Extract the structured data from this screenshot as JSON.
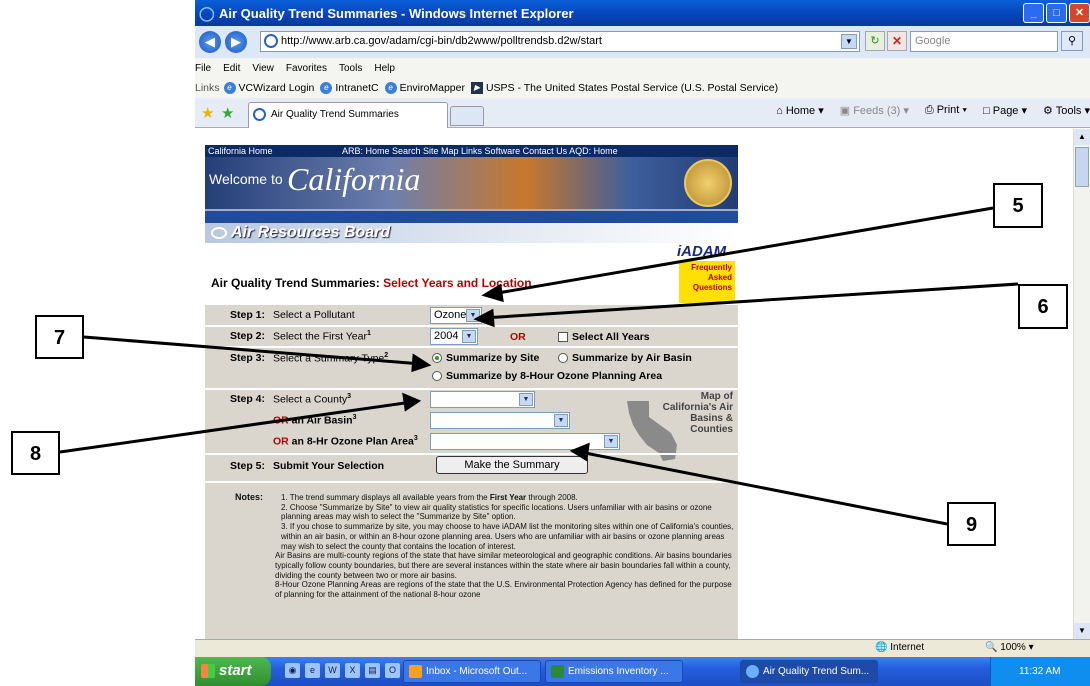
{
  "browser": {
    "title": "Air Quality Trend Summaries - Windows Internet Explorer",
    "url": "http://www.arb.ca.gov/adam/cgi-bin/db2www/polltrendsb.d2w/start",
    "search_placeholder": "Google",
    "menu": [
      "File",
      "Edit",
      "View",
      "Favorites",
      "Tools",
      "Help"
    ],
    "links_label": "Links",
    "links": [
      "VCWizard Login",
      "IntranetC",
      "EnviroMapper",
      "USPS - The United States Postal Service (U.S. Postal Service)"
    ],
    "tab_label": "Air Quality Trend Summaries",
    "commands": {
      "home": "Home",
      "feeds": "Feeds (3)",
      "print": "Print",
      "page": "Page",
      "tools": "Tools"
    },
    "status_zone": "Internet",
    "zoom": "100%"
  },
  "site": {
    "top_left": "California Home",
    "top_links": "ARB: Home  Search  Site Map  Links  Software  Contact Us  AQD: Home",
    "welcome": "Welcome to",
    "california": "California",
    "board": "Air Resources Board",
    "iadam_logo": "iADAM",
    "faq": "Frequently Asked Questions",
    "title_main": "Air Quality Trend Summaries:",
    "title_sub": "Select Years and Location"
  },
  "form": {
    "step1": {
      "label": "Step 1:",
      "text": "Select a Pollutant",
      "value": "Ozone"
    },
    "step2": {
      "label": "Step 2:",
      "text": "Select the First Year",
      "sup": "1",
      "value": "2004",
      "or": "OR",
      "all_years": "Select All Years"
    },
    "step3": {
      "label": "Step 3:",
      "text": "Select a Summary Type",
      "sup": "2",
      "opt_site": "Summarize by Site",
      "opt_basin": "Summarize by Air Basin",
      "opt_ozone": "Summarize by 8-Hour Ozone Planning Area"
    },
    "step4": {
      "label": "Step 4:",
      "text": "Select a County",
      "sup": "3",
      "or": "OR",
      "basin_text": "an Air Basin",
      "plan_text": "an 8-Hr Ozone Plan Area"
    },
    "step5": {
      "label": "Step 5:",
      "text": "Submit Your Selection",
      "button": "Make the Summary"
    },
    "map_text": "Map of California's Air Basins & Counties"
  },
  "notes": {
    "heading": "Notes:",
    "n1_pre": "1. The trend summary displays all available years from the ",
    "n1_bold": "First Year",
    "n1_post": " through 2008.",
    "n2": "2. Choose \"Summarize by Site\" to view air quality statistics for specific locations. Users unfamiliar with air basins or ozone planning areas may wish to select the \"Summarize by Site\" option.",
    "n3": "3. If you chose to summarize by site, you may choose to have iADAM list the monitoring sites within one of California's counties, within an air basin, or within an 8-hour ozone planning area. Users who are unfamiliar with air basins or ozone planning areas may wish to select the county that contains the location of interest.",
    "n4": "Air Basins are multi-county regions of the state that have similar meteorological and geographic conditions. Air basins boundaries typically follow county boundaries, but there are several instances within the state where air basin boundaries fall within a county, dividing the county between two or more air basins.",
    "n5": "8-Hour Ozone Planning Areas are regions of the state that the U.S. Environmental Protection Agency has defined for the purpose of planning for the attainment of the national 8-hour ozone"
  },
  "taskbar": {
    "start": "start",
    "tasks": [
      "Inbox - Microsoft Out...",
      "Emissions Inventory ...",
      "Air Quality Trend Sum..."
    ],
    "time": "11:32 AM"
  },
  "callouts": [
    "5",
    "6",
    "7",
    "8",
    "9"
  ],
  "colors": {
    "accent_red": "#b00000",
    "form_bg": "#dad6cd",
    "ie_blue": "#0743b8"
  }
}
